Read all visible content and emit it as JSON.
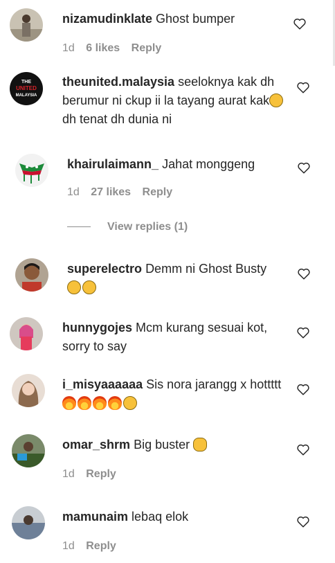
{
  "comments": [
    {
      "username": "nizamudinklate",
      "text": "Ghost bumper",
      "time": "1d",
      "likes": "6 likes",
      "reply": "Reply"
    },
    {
      "username": "theunited.malaysia",
      "text": "seeloknya kak dh berumur ni ckup ii la tayang aurat kak",
      "text_after": "dh tenat dh dunia ni",
      "avatar_text": [
        "THE",
        "UNITED",
        "MALAYSIA"
      ]
    },
    {
      "username": "khairulaimann_",
      "text": "Jahat monggeng",
      "time": "1d",
      "likes": "27 likes",
      "reply": "Reply",
      "view_replies": "View replies (1)"
    },
    {
      "username": "superelectro",
      "text": "Demm ni Ghost Busty"
    },
    {
      "username": "hunnygojes",
      "text": "Mcm kurang sesuai kot, sorry to say"
    },
    {
      "username": "i_misyaaaaaa",
      "text": "Sis nora jarangg x hottttt"
    },
    {
      "username": "omar_shrm",
      "text": "Big buster",
      "time": "1d",
      "reply": "Reply"
    },
    {
      "username": "mamunaim",
      "text": "lebaq elok",
      "time": "1d",
      "reply": "Reply"
    }
  ],
  "icons": {
    "like": "heart-outline-icon"
  },
  "colors": {
    "text": "#262626",
    "meta": "#8e8e8e"
  }
}
